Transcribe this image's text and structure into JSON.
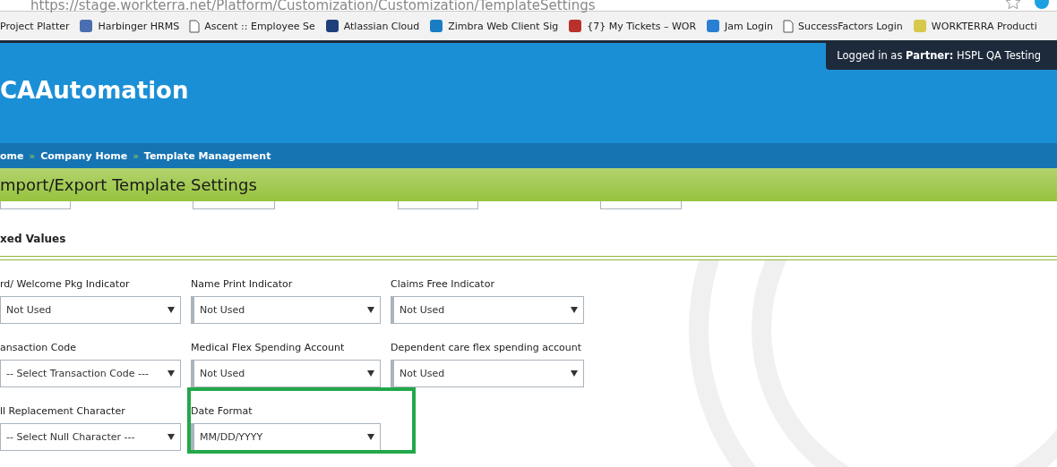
{
  "browser": {
    "url": "https://stage.workterra.net/Platform/Customization/Customization/TemplateSettings",
    "bookmarks": [
      {
        "label": "Project Platter",
        "kind": "none"
      },
      {
        "label": "Harbinger HRMS",
        "kind": "site",
        "color": "#4a6fb0"
      },
      {
        "label": "Ascent :: Employee Se",
        "kind": "page"
      },
      {
        "label": "Atlassian Cloud",
        "kind": "site",
        "color": "#1d3f7a"
      },
      {
        "label": "Zimbra Web Client Sig",
        "kind": "site",
        "color": "#1a7dc4"
      },
      {
        "label": "{7} My Tickets – WOR",
        "kind": "site",
        "color": "#b8322b"
      },
      {
        "label": "Jam Login",
        "kind": "site",
        "color": "#2a7fd4"
      },
      {
        "label": "SuccessFactors Login",
        "kind": "page"
      },
      {
        "label": "WORKTERRA Producti",
        "kind": "site",
        "color": "#d8c84a"
      }
    ]
  },
  "header": {
    "title": "CAAutomation",
    "login": "Logged in as **Partner:**  HSPL QA Testing",
    "breadcrumb": {
      "separator": "»",
      "items": [
        "ome",
        "Company Home",
        "Template Management"
      ]
    }
  },
  "page_title": "mport/Export Template Settings",
  "section": {
    "title": "xed Values",
    "fields": [
      {
        "label": "rd/ Welcome Pkg Indicator",
        "value": "Not Used",
        "highlighted": false
      },
      {
        "label": "Name Print Indicator",
        "value": "Not Used",
        "highlighted": false
      },
      {
        "label": "Claims Free Indicator",
        "value": "Not Used",
        "highlighted": false
      },
      {
        "label": "ansaction Code",
        "value": "-- Select Transaction Code ---",
        "highlighted": false
      },
      {
        "label": "Medical Flex Spending Account",
        "value": "Not Used",
        "highlighted": false
      },
      {
        "label": "Dependent care flex spending account",
        "value": "Not Used",
        "highlighted": false
      },
      {
        "label": "ll Replacement Character",
        "value": "-- Select Null Character ---",
        "highlighted": false
      },
      {
        "label": "Date Format",
        "value": "MM/DD/YYYY",
        "highlighted": true
      }
    ]
  }
}
